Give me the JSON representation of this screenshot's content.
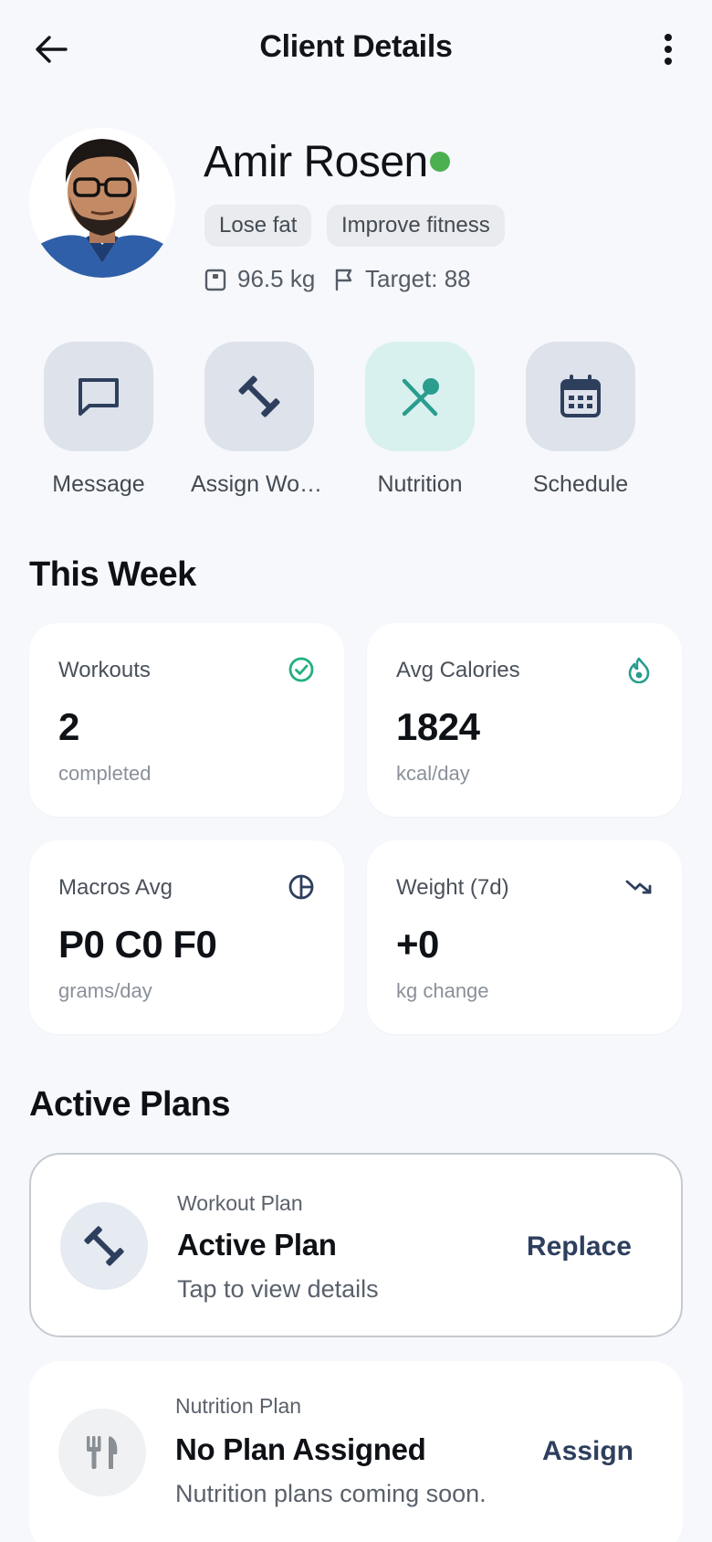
{
  "header": {
    "title": "Client Details",
    "back_icon": "arrow-left-icon",
    "more_icon": "more-vertical-icon"
  },
  "client": {
    "name": "Amir Rosen",
    "status": "online",
    "goals": [
      "Lose fat",
      "Improve fitness"
    ],
    "weight": "96.5 kg",
    "target": "Target: 88"
  },
  "actions": [
    {
      "label": "Message",
      "icon": "chat-icon"
    },
    {
      "label": "Assign Workout",
      "icon": "dumbbell-icon"
    },
    {
      "label": "Nutrition",
      "icon": "utensils-icon"
    },
    {
      "label": "Schedule",
      "icon": "calendar-icon"
    }
  ],
  "this_week": {
    "title": "This Week",
    "cards": [
      {
        "label": "Workouts",
        "value": "2",
        "unit": "completed",
        "icon": "check-circle-icon"
      },
      {
        "label": "Avg Calories",
        "value": "1824",
        "unit": "kcal/day",
        "icon": "flame-icon"
      },
      {
        "label": "Macros Avg",
        "value": "P0 C0 F0",
        "unit": "grams/day",
        "icon": "pie-chart-icon"
      },
      {
        "label": "Weight (7d)",
        "value": "+0",
        "unit": "kg change",
        "icon": "trending-down-icon"
      }
    ]
  },
  "active_plans": {
    "title": "Active Plans",
    "workout": {
      "kicker": "Workout Plan",
      "title": "Active Plan",
      "subtitle": "Tap to view details",
      "action": "Replace"
    },
    "nutrition": {
      "kicker": "Nutrition Plan",
      "title": "No Plan Assigned",
      "subtitle": "Nutrition plans coming soon.",
      "action": "Assign"
    }
  },
  "colors": {
    "background": "#f6f8fc",
    "accent_navy": "#2e3f5e",
    "accent_teal": "#2a9d8f",
    "online_green": "#4caf50",
    "success_green": "#22b07d"
  }
}
